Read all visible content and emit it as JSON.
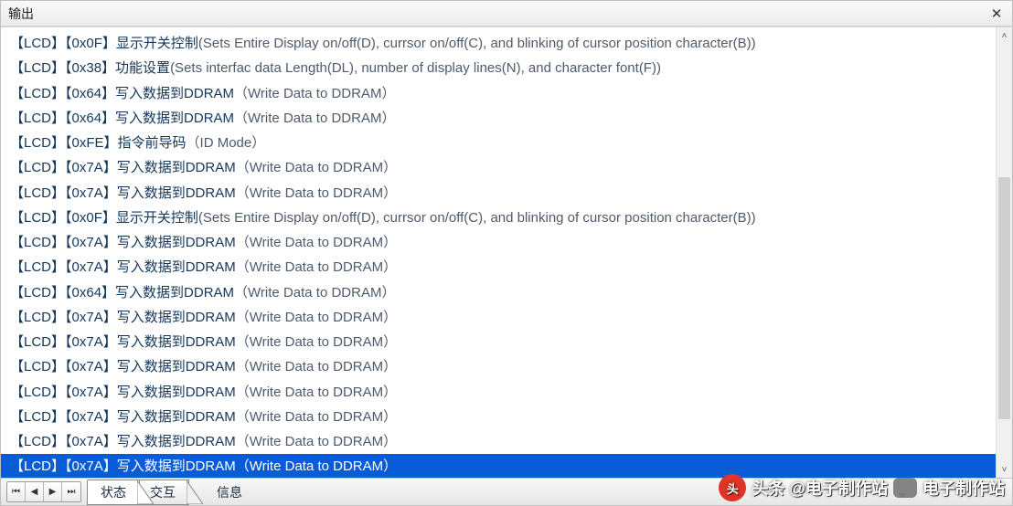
{
  "window": {
    "title": "输出",
    "close_tooltip": "Close"
  },
  "log": {
    "selected_index": 17,
    "lines": [
      {
        "tag1": "【LCD】",
        "tag2": "【0x0F】",
        "desc": "显示开关控制",
        "en": "(Sets Entire Display on/off(D), currsor on/off(C), and blinking of cursor position character(B))"
      },
      {
        "tag1": "【LCD】",
        "tag2": "【0x38】",
        "desc": "功能设置",
        "en": "(Sets interfac data Length(DL), number of display lines(N), and character font(F))"
      },
      {
        "tag1": "【LCD】",
        "tag2": "【0x64】",
        "desc": "写入数据到DDRAM",
        "en": "（Write Data to DDRAM）"
      },
      {
        "tag1": "【LCD】",
        "tag2": "【0x64】",
        "desc": "写入数据到DDRAM",
        "en": "（Write Data to DDRAM）"
      },
      {
        "tag1": "【LCD】",
        "tag2": "【0xFE】",
        "desc": "指令前导码",
        "en": "（ID Mode）"
      },
      {
        "tag1": "【LCD】",
        "tag2": "【0x7A】",
        "desc": "写入数据到DDRAM",
        "en": "（Write Data to DDRAM）"
      },
      {
        "tag1": "【LCD】",
        "tag2": "【0x7A】",
        "desc": "写入数据到DDRAM",
        "en": "（Write Data to DDRAM）"
      },
      {
        "tag1": "【LCD】",
        "tag2": "【0x0F】",
        "desc": "显示开关控制",
        "en": "(Sets Entire Display on/off(D), currsor on/off(C), and blinking of cursor position character(B))"
      },
      {
        "tag1": "【LCD】",
        "tag2": "【0x7A】",
        "desc": "写入数据到DDRAM",
        "en": "（Write Data to DDRAM）"
      },
      {
        "tag1": "【LCD】",
        "tag2": "【0x7A】",
        "desc": "写入数据到DDRAM",
        "en": "（Write Data to DDRAM）"
      },
      {
        "tag1": "【LCD】",
        "tag2": "【0x64】",
        "desc": "写入数据到DDRAM",
        "en": "（Write Data to DDRAM）"
      },
      {
        "tag1": "【LCD】",
        "tag2": "【0x7A】",
        "desc": "写入数据到DDRAM",
        "en": "（Write Data to DDRAM）"
      },
      {
        "tag1": "【LCD】",
        "tag2": "【0x7A】",
        "desc": "写入数据到DDRAM",
        "en": "（Write Data to DDRAM）"
      },
      {
        "tag1": "【LCD】",
        "tag2": "【0x7A】",
        "desc": "写入数据到DDRAM",
        "en": "（Write Data to DDRAM）"
      },
      {
        "tag1": "【LCD】",
        "tag2": "【0x7A】",
        "desc": "写入数据到DDRAM",
        "en": "（Write Data to DDRAM）"
      },
      {
        "tag1": "【LCD】",
        "tag2": "【0x7A】",
        "desc": "写入数据到DDRAM",
        "en": "（Write Data to DDRAM）"
      },
      {
        "tag1": "【LCD】",
        "tag2": "【0x7A】",
        "desc": "写入数据到DDRAM",
        "en": "（Write Data to DDRAM）"
      },
      {
        "tag1": "【LCD】",
        "tag2": "【0x7A】",
        "desc": "写入数据到DDRAM",
        "en": "（Write Data to DDRAM）"
      }
    ]
  },
  "nav": {
    "first": "⏮",
    "prev": "◀",
    "next": "▶",
    "last": "⏭"
  },
  "tabs": {
    "status": "状态",
    "interact": "交互",
    "info": "信息",
    "active_index": 0
  },
  "watermark": {
    "left_prefix": "头条",
    "left_text": " @电子制作站",
    "right_text": "电子制作站"
  },
  "colors": {
    "selection": "#0a5bd6",
    "text": "#14375a"
  }
}
